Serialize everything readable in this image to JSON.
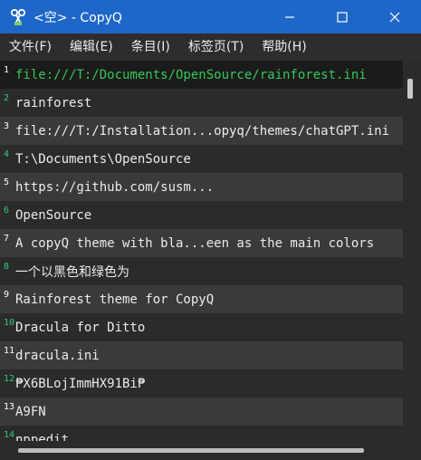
{
  "window": {
    "title": "<空> - CopyQ",
    "accent": "#1e67c8"
  },
  "menu": [
    {
      "label": "文件(F)"
    },
    {
      "label": "编辑(E)"
    },
    {
      "label": "条目(I)"
    },
    {
      "label": "标签页(T)"
    },
    {
      "label": "帮助(H)"
    }
  ],
  "items": [
    {
      "num": "1",
      "text": "file:///T:/Documents/OpenSource/rainforest.ini"
    },
    {
      "num": "2",
      "text": "rainforest"
    },
    {
      "num": "3",
      "text": "file:///T:/Installation...opyq/themes/chatGPT.ini"
    },
    {
      "num": "4",
      "text": "T:\\Documents\\OpenSource"
    },
    {
      "num": "5",
      "text": "https://github.com/susm..."
    },
    {
      "num": "6",
      "text": "OpenSource"
    },
    {
      "num": "7",
      "text": "A copyQ theme with bla...een as the main colors"
    },
    {
      "num": "8",
      "text": "一个以黑色和绿色为"
    },
    {
      "num": "9",
      "text": "Rainforest theme for CopyQ"
    },
    {
      "num": "10",
      "text": "Dracula for Ditto"
    },
    {
      "num": "11",
      "text": "dracula.ini"
    },
    {
      "num": "12",
      "text": "₱X6BLojImmHX91Bi₱"
    },
    {
      "num": "13",
      "text": "A9FN"
    },
    {
      "num": "14",
      "text": "nppedit"
    }
  ]
}
